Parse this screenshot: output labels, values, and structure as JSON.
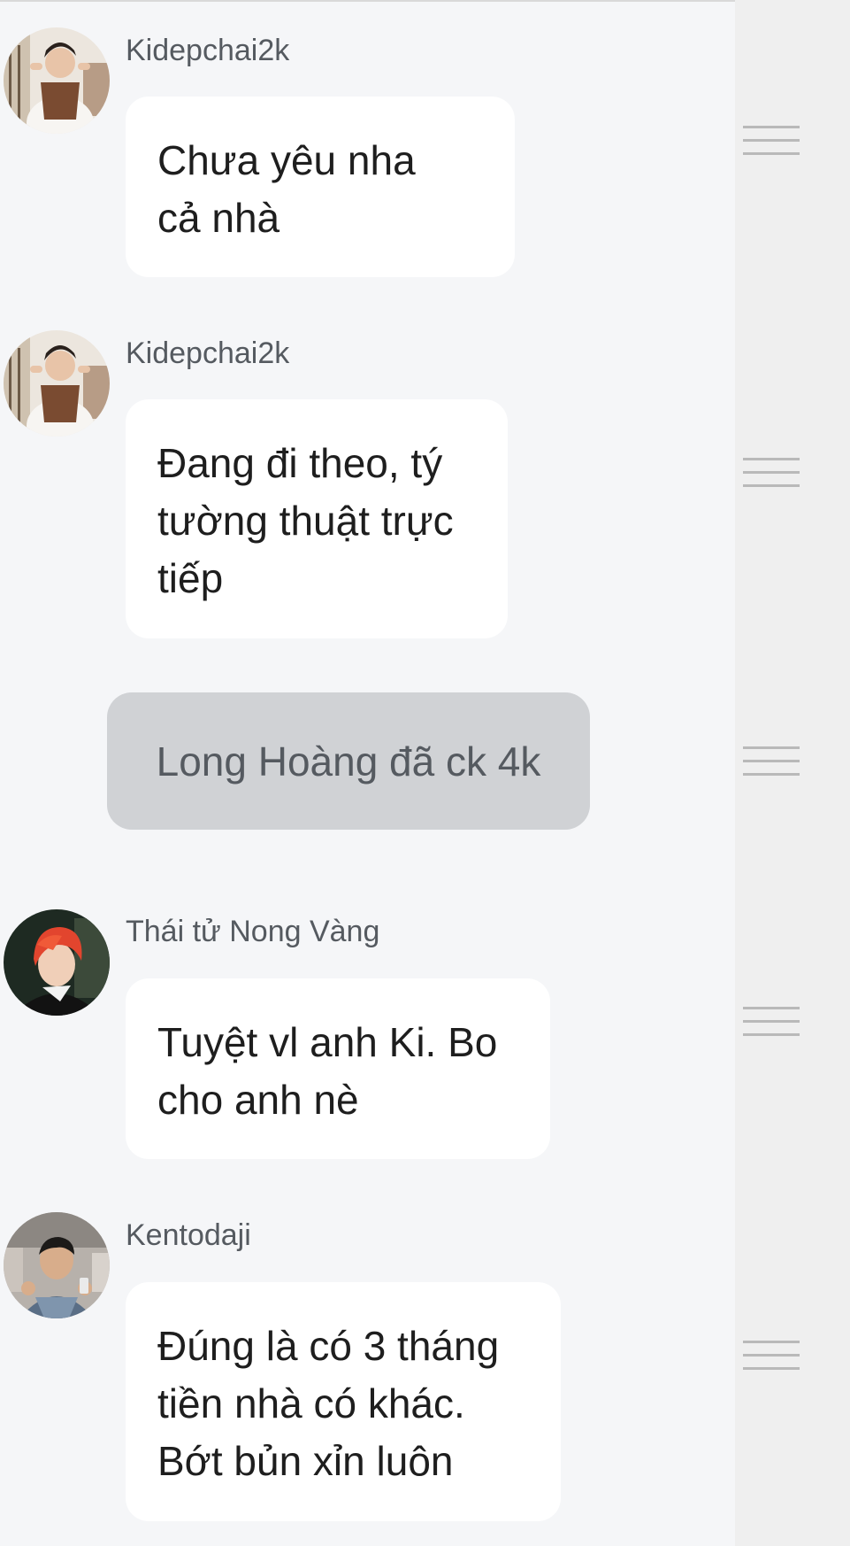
{
  "messages": [
    {
      "username": "Kidepchai2k",
      "text": "Chưa yêu nha\ncả nhà",
      "avatar_icon": "user-avatar-kidepchai2k"
    },
    {
      "username": "Kidepchai2k",
      "text": "Đang đi theo, tý\ntường thuật trực\ntiếp",
      "avatar_icon": "user-avatar-kidepchai2k"
    },
    {
      "username": "Thái tử Nong Vàng",
      "text": "Tuyệt vl anh Ki. Bo\ncho anh nè",
      "avatar_icon": "user-avatar-thai-tu-nong-vang"
    },
    {
      "username": "Kentodaji",
      "text": "Đúng là có 3 tháng\ntiền nhà có khác.\nBớt bủn xỉn luôn",
      "avatar_icon": "user-avatar-kentodaji"
    }
  ],
  "system_message": {
    "text": "Long Hoàng đã ck 4k"
  },
  "colors": {
    "background": "#f5f6f8",
    "bubble": "#ffffff",
    "system_bubble": "#d0d2d5",
    "text": "#1e1e1e",
    "username": "#555a60",
    "handle": "#b9b9b9"
  },
  "icons": {
    "drag_handle": "drag-handle-icon"
  }
}
